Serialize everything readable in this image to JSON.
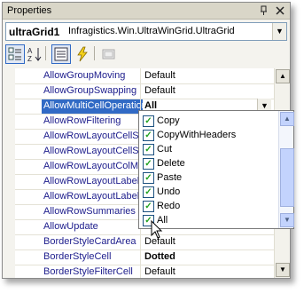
{
  "window": {
    "title": "Properties",
    "pin_glyph": "∙",
    "close_glyph": "×"
  },
  "object_selector": {
    "name": "ultraGrid1",
    "type": "Infragistics.Win.UltraWinGrid.UltraGrid"
  },
  "toolbar": {
    "categorized": "categorized-icon",
    "alphabetical": "alphabetical-icon",
    "properties": "properties-icon",
    "events": "events-icon",
    "pages": "property-pages-icon"
  },
  "properties": [
    {
      "name": "AllowGroupMoving",
      "value": "Default"
    },
    {
      "name": "AllowGroupSwapping",
      "value": "Default"
    },
    {
      "name": "AllowMultiCellOperation",
      "value": "All"
    },
    {
      "name": "AllowRowFiltering",
      "value": ""
    },
    {
      "name": "AllowRowLayoutCellSiz",
      "value": ""
    },
    {
      "name": "AllowRowLayoutCellSp",
      "value": ""
    },
    {
      "name": "AllowRowLayoutColMo",
      "value": ""
    },
    {
      "name": "AllowRowLayoutLabelS",
      "value": ""
    },
    {
      "name": "AllowRowLayoutLabelS",
      "value": ""
    },
    {
      "name": "AllowRowSummaries",
      "value": ""
    },
    {
      "name": "AllowUpdate",
      "value": ""
    },
    {
      "name": "BorderStyleCardArea",
      "value": "Default"
    },
    {
      "name": "BorderStyleCell",
      "value": "Dotted"
    },
    {
      "name": "BorderStyleFilterCell",
      "value": "Default"
    }
  ],
  "dropdown": {
    "items": [
      {
        "label": "Copy",
        "checked": true
      },
      {
        "label": "CopyWithHeaders",
        "checked": true
      },
      {
        "label": "Cut",
        "checked": true
      },
      {
        "label": "Delete",
        "checked": true
      },
      {
        "label": "Paste",
        "checked": true
      },
      {
        "label": "Undo",
        "checked": true
      },
      {
        "label": "Redo",
        "checked": true
      },
      {
        "label": "All",
        "checked": true
      }
    ]
  },
  "colors": {
    "selection": "#316ac5",
    "check": "#21a121",
    "accent_border": "#7f9db9"
  }
}
